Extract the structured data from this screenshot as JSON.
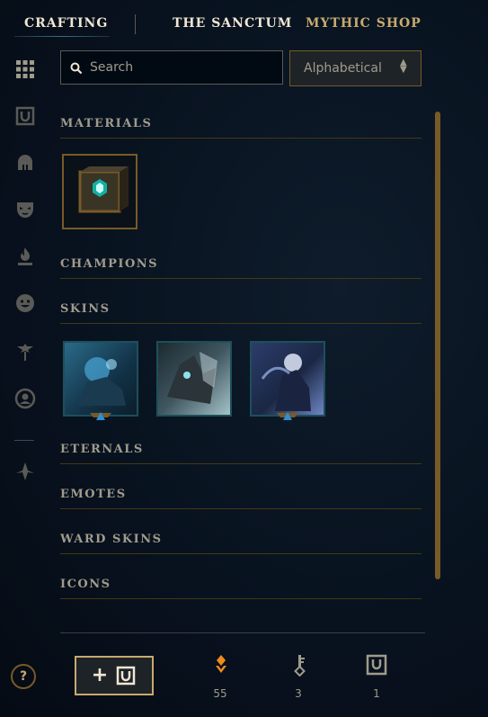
{
  "nav": {
    "tabs": [
      {
        "label": "CRAFTING"
      },
      {
        "label": "THE SANCTUM"
      },
      {
        "label": "MYTHIC SHOP"
      }
    ]
  },
  "sidebar": {
    "icons": [
      "grid-icon",
      "chest-icon",
      "champion-helmet-icon",
      "mask-icon",
      "fire-icon",
      "emote-icon",
      "ward-icon",
      "profile-icon",
      "mythic-icon"
    ]
  },
  "search": {
    "placeholder": "Search",
    "value": ""
  },
  "sort": {
    "selected": "Alphabetical"
  },
  "sections": {
    "materials": "MATERIALS",
    "champions": "CHAMPIONS",
    "skins": "SKINS",
    "eternals": "ETERNALS",
    "emotes": "EMOTES",
    "ward_skins": "WARD SKINS",
    "icons": "ICONS"
  },
  "footer": {
    "help_label": "?",
    "add_label": "+",
    "counts": {
      "orange_essence": "55",
      "keys": "3",
      "chests": "1"
    }
  },
  "colors": {
    "gold": "#c8aa6e",
    "gold_dark": "#785a28",
    "teal": "#1e4f5a",
    "text": "#a09b8c"
  }
}
